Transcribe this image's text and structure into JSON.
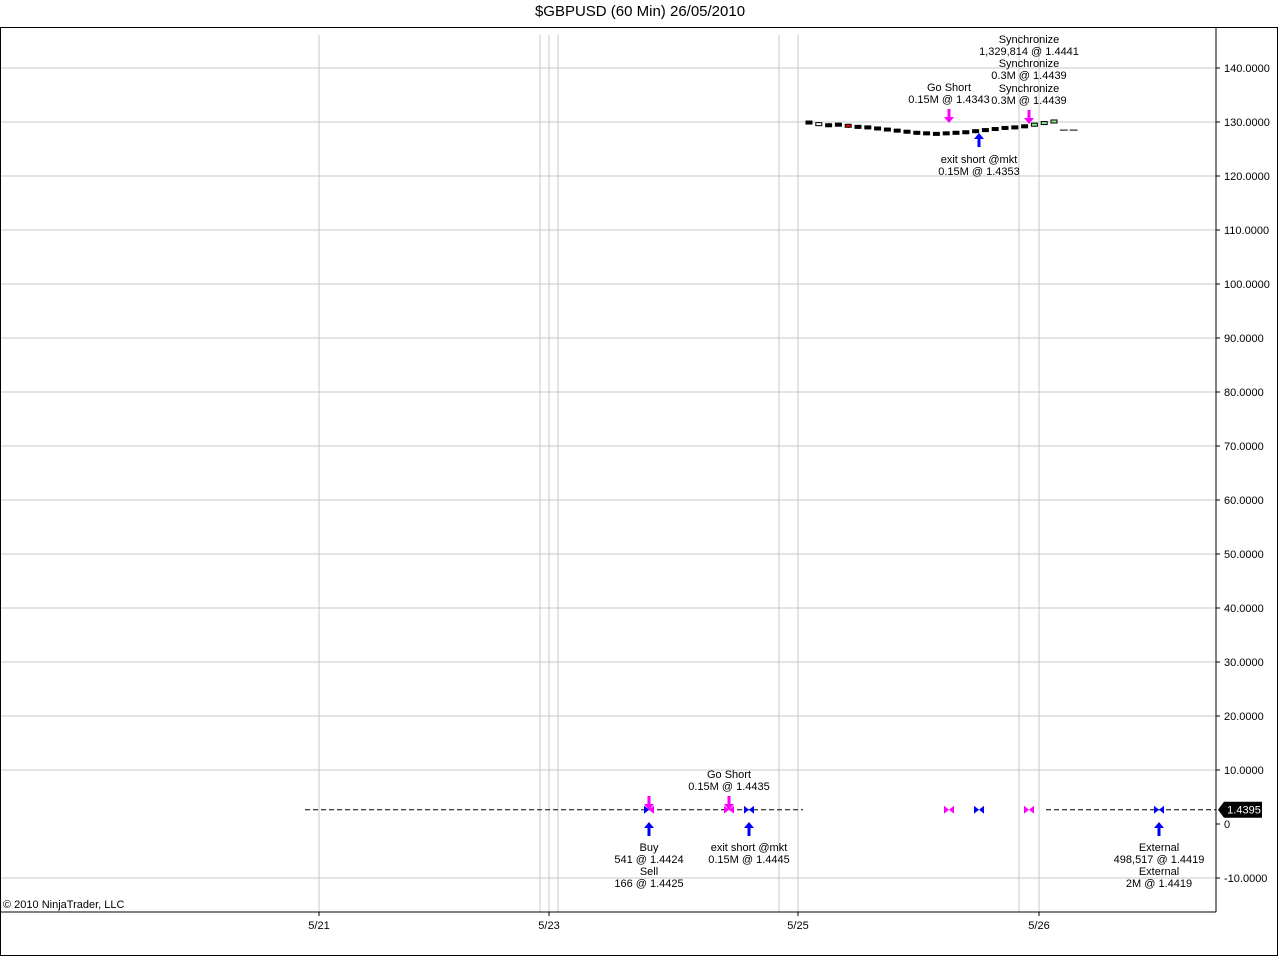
{
  "title": "$GBPUSD (60 Min)  26/05/2010",
  "copyright": "© 2010 NinjaTrader, LLC",
  "colors": {
    "grid": "#c8c8c8",
    "sell_marker": "#ff00ff",
    "buy_marker": "#0000ff",
    "price_box": "#000000",
    "candle_up": "#90ee90",
    "candle_down": "#ff0000"
  },
  "chart_data": {
    "type": "candlestick",
    "title": "$GBPUSD (60 Min)  26/05/2010",
    "ylim": [
      -15,
      145
    ],
    "yticks": [
      -10,
      0,
      10,
      20,
      30,
      40,
      50,
      60,
      70,
      80,
      90,
      100,
      110,
      120,
      130,
      140
    ],
    "ytick_labels": [
      "-10.0000",
      "0",
      "10.0000",
      "20.0000",
      "30.0000",
      "40.0000",
      "50.0000",
      "60.0000",
      "70.0000",
      "80.0000",
      "90.0000",
      "100.0000",
      "110.0000",
      "120.0000",
      "130.0000",
      "140.0000"
    ],
    "xtick_labels": [
      "5/21",
      "5/23",
      "5/25",
      "5/26"
    ],
    "current_price": "1.4395",
    "price_line_level": 1.4395,
    "grid": true,
    "bars_close": [
      129.9,
      129.6,
      129.4,
      129.5,
      129.3,
      129.1,
      129.0,
      128.8,
      128.6,
      128.4,
      128.2,
      128.0,
      127.9,
      127.8,
      127.9,
      128.0,
      128.1,
      128.3,
      128.5,
      128.7,
      128.9,
      129.0,
      129.2,
      129.5,
      129.8,
      130.1,
      128.5,
      128.5
    ],
    "trade_markers": [
      {
        "side": "sell",
        "level": 1.4395
      },
      {
        "side": "sell",
        "level": 1.4395
      },
      {
        "side": "buy",
        "level": 1.4395
      },
      {
        "side": "sell",
        "level": 1.4395
      },
      {
        "side": "buy",
        "level": 1.4395
      },
      {
        "side": "sell",
        "level": 1.4395
      },
      {
        "side": "buy",
        "level": 1.4395
      }
    ],
    "annotations": [
      {
        "lines": [
          "Buy",
          "541 @ 1.4424",
          "Sell",
          "166 @ 1.4425"
        ]
      },
      {
        "lines": [
          "Go Short",
          "0.15M @ 1.4435"
        ]
      },
      {
        "lines": [
          "exit short @mkt",
          "0.15M @ 1.4445"
        ]
      },
      {
        "lines": [
          "External",
          "498,517 @ 1.4419",
          "External",
          "2M @ 1.4419"
        ]
      },
      {
        "lines": [
          "Synchronize",
          "1,329,814 @ 1.4441",
          "Synchronize",
          "0.3M @ 1.4439",
          "Synchronize",
          "0.3M @ 1.4439"
        ]
      },
      {
        "lines": [
          "Go Short",
          "0.15M @ 1.4343"
        ]
      },
      {
        "lines": [
          "exit short @mkt",
          "0.15M @ 1.4353"
        ]
      }
    ]
  }
}
